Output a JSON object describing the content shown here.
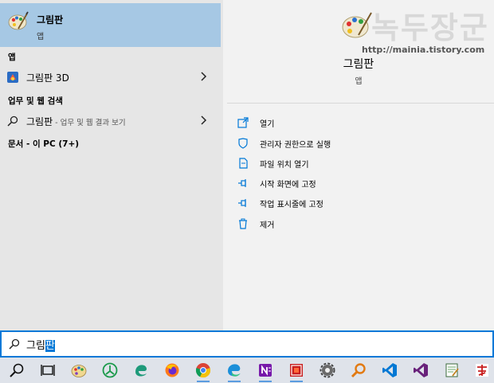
{
  "best_match": {
    "title": "그림판",
    "subtitle": "앱"
  },
  "apps_section": {
    "heading": "앱",
    "items": [
      {
        "label": "그림판 3D"
      }
    ]
  },
  "web_section": {
    "heading": "업무 및 웹 검색",
    "items": [
      {
        "label": "그림판",
        "hint": " - 업무 및 웹 결과 보기"
      }
    ]
  },
  "docs_section": {
    "heading": "문서 - 이 PC (7+)"
  },
  "detail": {
    "title": "그림판",
    "subtitle": "앱",
    "actions": [
      {
        "label": "열기",
        "icon": "open-icon"
      },
      {
        "label": "관리자 권한으로 실행",
        "icon": "shield-icon"
      },
      {
        "label": "파일 위치 열기",
        "icon": "file-icon"
      },
      {
        "label": "시작 화면에 고정",
        "icon": "pin-icon"
      },
      {
        "label": "작업 표시줄에 고정",
        "icon": "pin-icon"
      },
      {
        "label": "제거",
        "icon": "trash-icon"
      }
    ]
  },
  "watermark": {
    "text": "녹두장군",
    "url": "http://mainia.tistory.com"
  },
  "search": {
    "query_plain": "그림",
    "query_selected": "판"
  },
  "taskbar": {
    "icons": [
      "search-icon",
      "task-view-icon",
      "paint-icon",
      "app-green-icon",
      "edge-legacy-icon",
      "firefox-icon",
      "chrome-icon",
      "edge-icon",
      "onenote-icon",
      "app-red-icon",
      "settings-gear-icon",
      "search-app-icon",
      "vscode-icon",
      "visual-studio-icon",
      "notepad-icon",
      "app-chinese-icon"
    ]
  },
  "colors": {
    "accent": "#0078d7",
    "selection": "#a6c8e4"
  }
}
